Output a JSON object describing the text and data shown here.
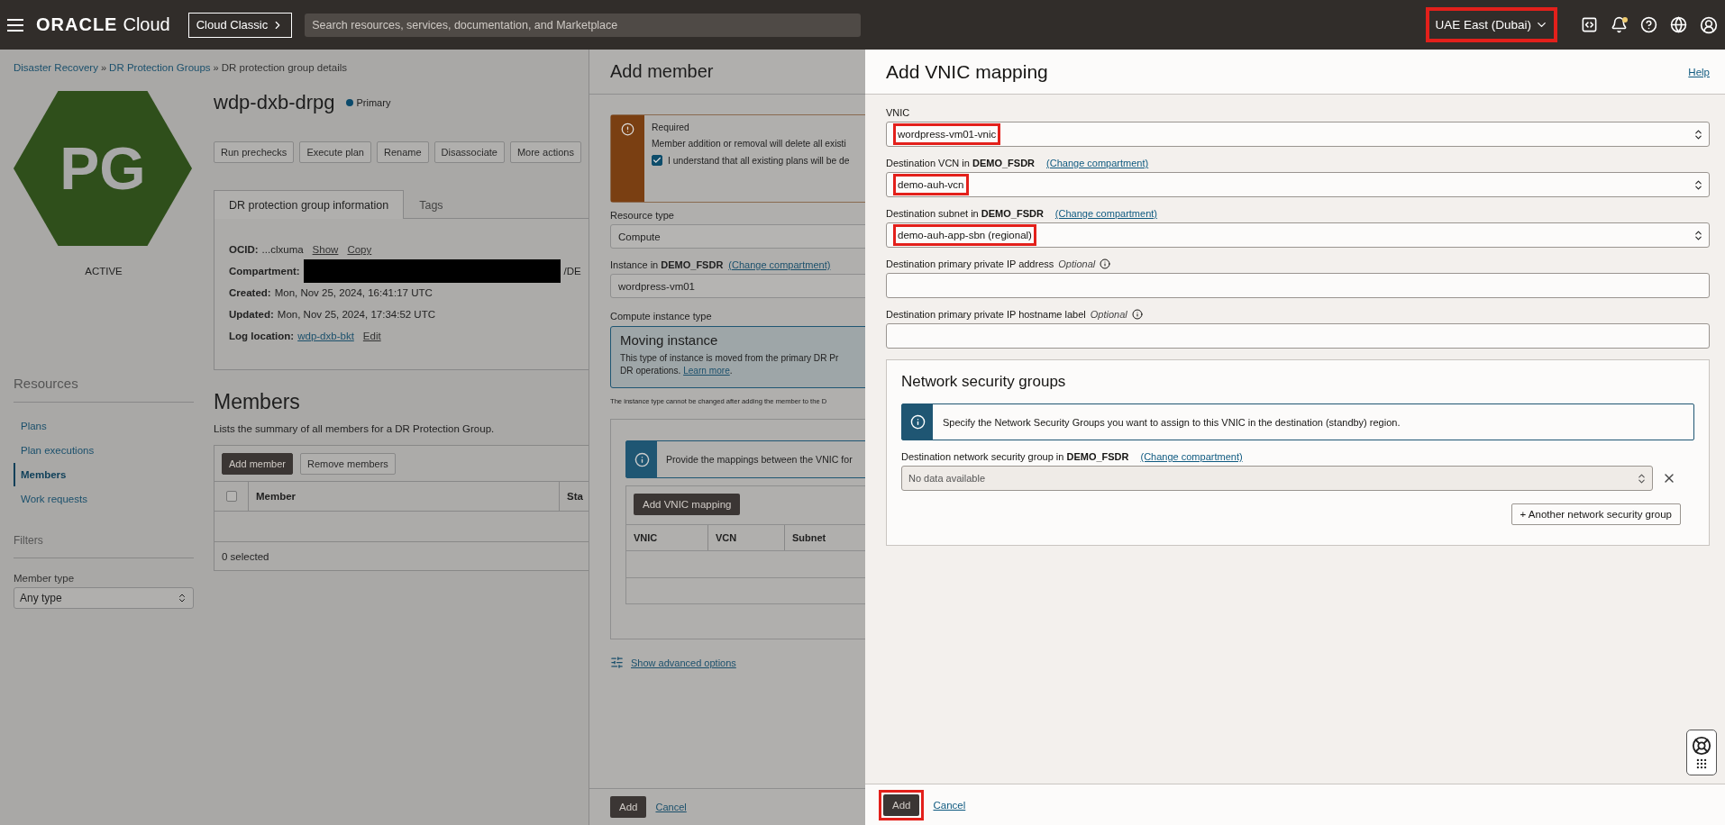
{
  "topbar": {
    "brand": "ORACLE",
    "brand_suffix": "Cloud",
    "classic_button": "Cloud Classic",
    "search": {
      "placeholder": "Search resources, services, documentation, and Marketplace"
    },
    "region": {
      "label": "UAE East (Dubai)",
      "highlighted": true
    }
  },
  "breadcrumb": [
    {
      "label": "Disaster Recovery",
      "kind": "link"
    },
    {
      "separator": "»",
      "label": "DR Protection Groups",
      "kind": "link"
    },
    {
      "separator": "»",
      "label": "DR protection group details",
      "kind": "current"
    }
  ],
  "badge": {
    "initials": "PG",
    "status": "ACTIVE"
  },
  "title": "wdp-dxb-drpg",
  "role": {
    "label": "Primary",
    "color": "#0b4a6b"
  },
  "actions": [
    "Run prechecks",
    "Execute plan",
    "Rename",
    "Disassociate",
    "More actions"
  ],
  "tabs": [
    {
      "label": "DR protection group information",
      "selected": true
    },
    {
      "label": "Tags",
      "selected": false
    }
  ],
  "info": [
    {
      "label": "OCID:",
      "value": "...clxuma",
      "links": [
        "Show",
        "Copy"
      ]
    },
    {
      "label": "Compartment:",
      "redacted": true,
      "value": "/DE"
    },
    {
      "label": "Created:",
      "value": "Mon, Nov 25, 2024, 16:41:17 UTC"
    },
    {
      "label": "Updated:",
      "value": "Mon, Nov 25, 2024, 17:34:52 UTC"
    },
    {
      "label": "Log location:",
      "value_link": "wdp-dxb-bkt",
      "links": [
        "Edit"
      ]
    }
  ],
  "resources": {
    "heading": "Resources",
    "items": [
      {
        "label": "Plans",
        "selected": false
      },
      {
        "label": "Plan executions",
        "selected": false
      },
      {
        "label": "Members",
        "selected": true
      },
      {
        "label": "Work requests",
        "selected": false
      }
    ]
  },
  "filters": {
    "heading": "Filters",
    "label": "Member type",
    "value": "Any type"
  },
  "members": {
    "heading": "Members",
    "description": "Lists the summary of all members for a DR Protection Group.",
    "buttons": [
      {
        "label": "Add member",
        "kind": "primary"
      },
      {
        "label": "Remove members",
        "kind": "secondary"
      }
    ],
    "select_all": {
      "checked": false
    },
    "columns": [
      "Member",
      "Sta"
    ],
    "footer": "0 selected"
  },
  "add_member": {
    "title": "Add member",
    "alert": {
      "title": "Required",
      "text": "Member addition or removal will delete all existi",
      "checkbox": {
        "label": "I understand that all existing plans will be de",
        "checked": true
      }
    },
    "resource_type": {
      "label": "Resource type",
      "value": "Compute"
    },
    "instance": {
      "label": "Instance in **DEMO_FSDR**",
      "link": "(Change compartment)",
      "value": "wordpress-vm01"
    },
    "instance_type": {
      "label": "Compute instance type",
      "card_title": "Moving instance",
      "card_text": "This type of instance is moved from the primary DR Pr",
      "card_text_end": "DR operations.",
      "card_link": "Learn more",
      "card_tail": ".",
      "note": "The instance type cannot be changed after adding the member to the D"
    },
    "vnic_info": "Provide the mappings between the VNIC for",
    "vnic_button": "Add VNIC mapping",
    "vnic_columns": [
      "VNIC",
      "VCN",
      "Subnet"
    ],
    "advanced_link": "Show advanced options",
    "footer": {
      "add": "Add",
      "cancel": "Cancel"
    }
  },
  "vnic_mapping": {
    "title": "Add VNIC mapping",
    "help": "Help",
    "fields": [
      {
        "kind": "select",
        "label": "VNIC",
        "value": "wordpress-vm01-vnic",
        "highlighted": true
      },
      {
        "kind": "select",
        "label": "Destination VCN in **DEMO_FSDR**",
        "link": "(Change compartment)",
        "value": "demo-auh-vcn",
        "highlighted": true
      },
      {
        "kind": "select",
        "label": "Destination subnet in **DEMO_FSDR**",
        "link": "(Change compartment)",
        "value": "demo-auh-app-sbn (regional)",
        "highlighted": true
      },
      {
        "kind": "text",
        "label": "Destination primary private IP address",
        "optional": "Optional"
      },
      {
        "kind": "text",
        "label": "Destination primary private IP hostname label",
        "optional": "Optional"
      }
    ],
    "nsg": {
      "title": "Network security groups",
      "info": "Specify the Network Security Groups you want to assign to this VNIC in the destination (standby) region.",
      "label": "Destination network security group in **DEMO_FSDR**",
      "link": "(Change compartment)",
      "placeholder": "No data available",
      "add_button": "+ Another network security group"
    },
    "footer": {
      "add": {
        "label": "Add",
        "highlighted": true
      },
      "cancel": "Cancel"
    }
  }
}
